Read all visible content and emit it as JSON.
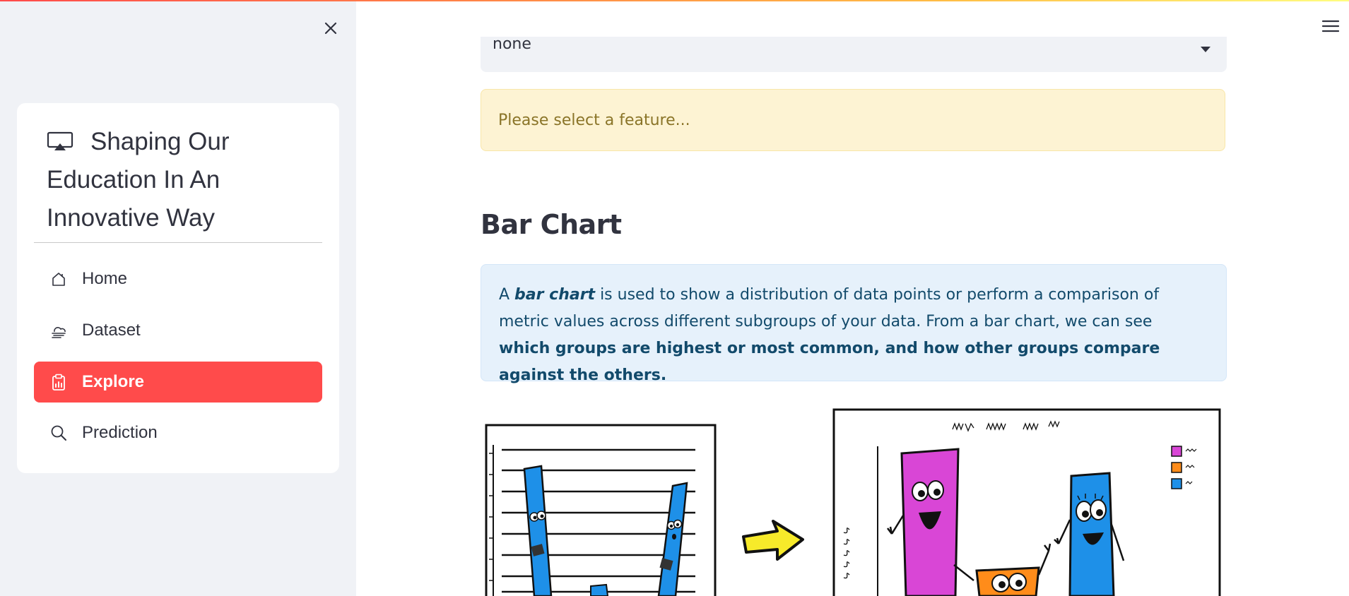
{
  "sidebar": {
    "close_icon": "close-icon",
    "menu": {
      "title": "Shaping Our Education In An Innovative Way",
      "title_icon": "airplay-icon",
      "items": [
        {
          "label": "Home",
          "icon": "house-icon",
          "active": false
        },
        {
          "label": "Dataset",
          "icon": "cloud-haze-icon",
          "active": false
        },
        {
          "label": "Explore",
          "icon": "clipboard-data-icon",
          "active": true
        },
        {
          "label": "Prediction",
          "icon": "search-icon",
          "active": false
        }
      ]
    },
    "active_color": "#ff4b4b"
  },
  "header": {
    "menu_icon": "hamburger-icon"
  },
  "main": {
    "feature_select": {
      "value": "none"
    },
    "warning": {
      "text": "Please select a feature..."
    },
    "section": {
      "title": "Bar Chart"
    },
    "info": {
      "p1": "A ",
      "p2": "bar chart",
      "p3": " is used to show a distribution of data points or perform a comparison of metric values across different subgroups of your data. From a bar chart, we can see ",
      "p4": "which groups are highest or most common, and how other groups compare against the others."
    }
  }
}
